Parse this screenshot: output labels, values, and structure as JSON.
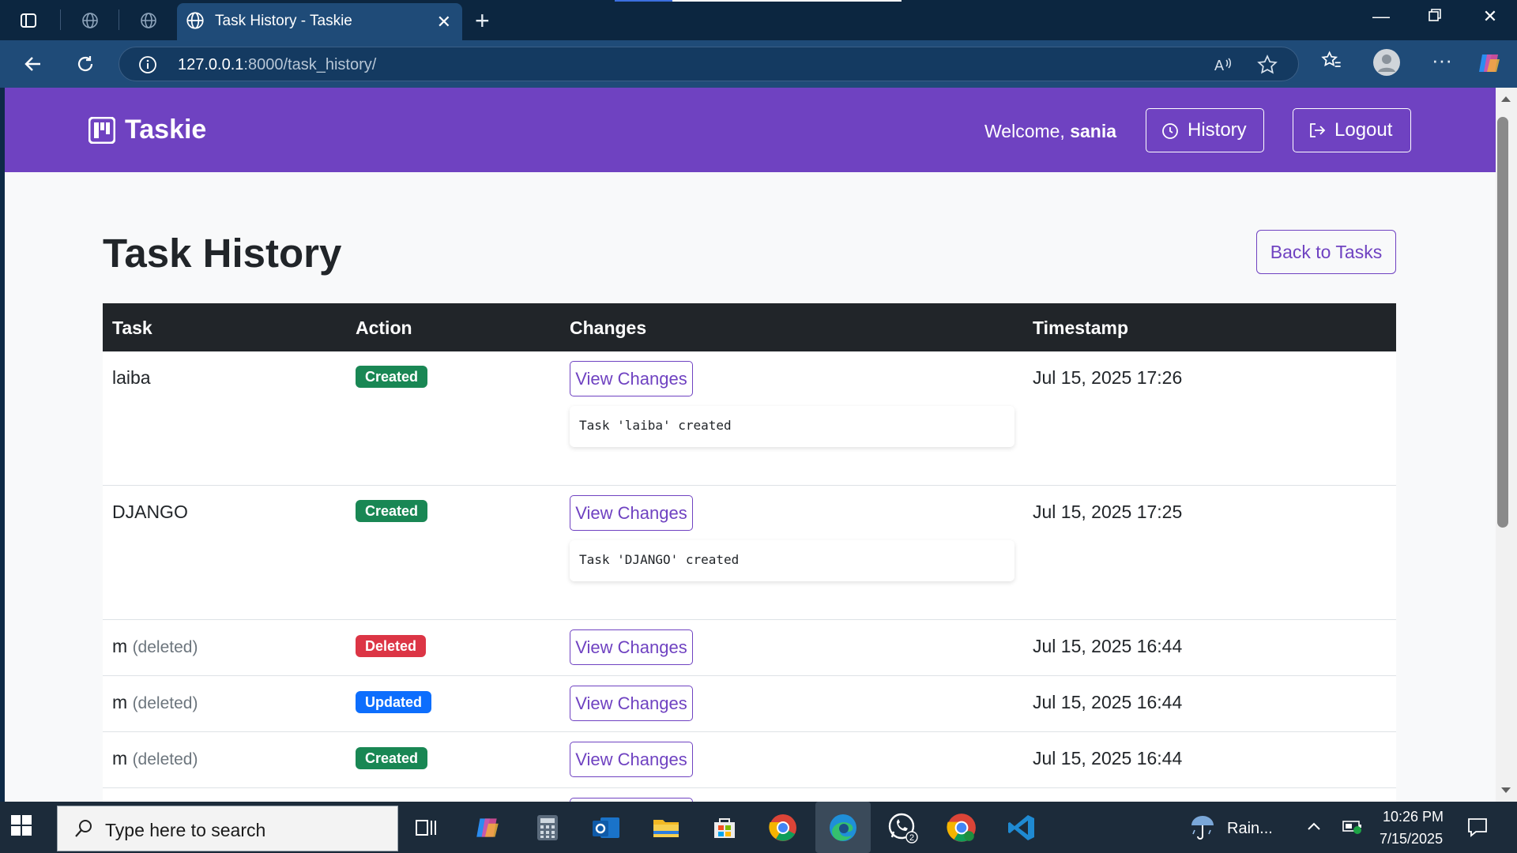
{
  "browser": {
    "tab_title": "Task History - Taskie",
    "url_host": "127.0.0.1",
    "url_rest": ":8000/task_history/"
  },
  "navbar": {
    "brand": "Taskie",
    "welcome_prefix": "Welcome, ",
    "username": "sania",
    "history_label": "History",
    "logout_label": "Logout"
  },
  "page": {
    "title": "Task History",
    "back_label": "Back to Tasks"
  },
  "table": {
    "headers": [
      "Task",
      "Action",
      "Changes",
      "Timestamp"
    ],
    "view_changes_label": "View Changes",
    "rows": [
      {
        "task": "laiba",
        "deleted_note": "",
        "action": "Created",
        "change": "Task 'laiba' created",
        "timestamp": "Jul 15, 2025 17:26"
      },
      {
        "task": "DJANGO",
        "deleted_note": "",
        "action": "Created",
        "change": "Task 'DJANGO' created",
        "timestamp": "Jul 15, 2025 17:25"
      },
      {
        "task": "m",
        "deleted_note": "(deleted)",
        "action": "Deleted",
        "change": "",
        "timestamp": "Jul 15, 2025 16:44"
      },
      {
        "task": "m",
        "deleted_note": "(deleted)",
        "action": "Updated",
        "change": "",
        "timestamp": "Jul 15, 2025 16:44"
      },
      {
        "task": "m",
        "deleted_note": "(deleted)",
        "action": "Created",
        "change": "",
        "timestamp": "Jul 15, 2025 16:44"
      }
    ]
  },
  "taskbar": {
    "search_placeholder": "Type here to search",
    "weather": "Rain...",
    "time": "10:26 PM",
    "date": "7/15/2025",
    "whatsapp_badge": "2"
  },
  "colors": {
    "brand": "#6f42c1",
    "created": "#198754",
    "deleted": "#dc3545",
    "updated": "#0d6efd"
  }
}
